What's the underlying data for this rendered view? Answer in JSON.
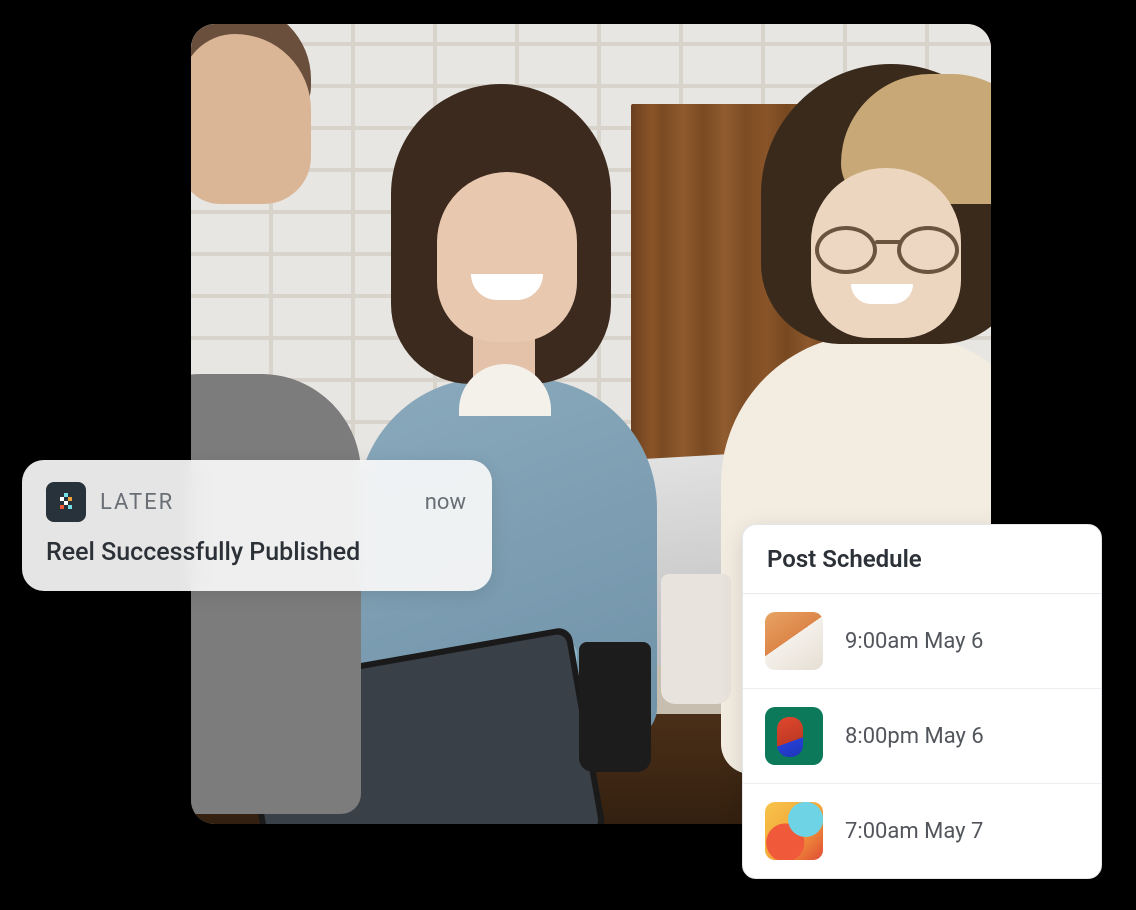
{
  "notification": {
    "app_name": "LATER",
    "time": "now",
    "message": "Reel Successfully Published",
    "app_icon": "later-app-icon"
  },
  "schedule": {
    "title": "Post Schedule",
    "items": [
      {
        "time": "9:00am May 6"
      },
      {
        "time": "8:00pm May 6"
      },
      {
        "time": "7:00am May 7"
      }
    ]
  }
}
